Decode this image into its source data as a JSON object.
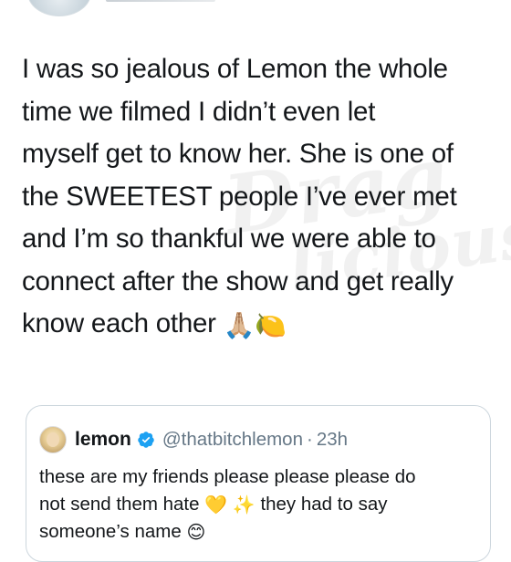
{
  "tweet": {
    "lines": [
      "I was so jealous of Lemon the whole",
      "time we filmed I didn’t even let",
      "myself get to know her. She is one of",
      "the SWEETEST people I’ve ever met",
      "and I’m so thankful we were able to",
      "connect after the show and get really",
      "know each other"
    ],
    "emojis": [
      "🙏🏼",
      "🍋"
    ]
  },
  "watermark": {
    "line1": "Drag",
    "line2": "licious"
  },
  "quoted_tweet": {
    "name": "lemon",
    "handle": "@thatbitchlemon",
    "separator": "·",
    "time": "23h",
    "lines": [
      "these are my friends please please please do",
      "not send them hate",
      "they had to say",
      "someone’s name"
    ],
    "emojis": [
      "💛",
      "✨",
      "😊"
    ],
    "icons": {
      "verified": "verified-badge-icon",
      "verified_color": "#1da1f2"
    }
  }
}
